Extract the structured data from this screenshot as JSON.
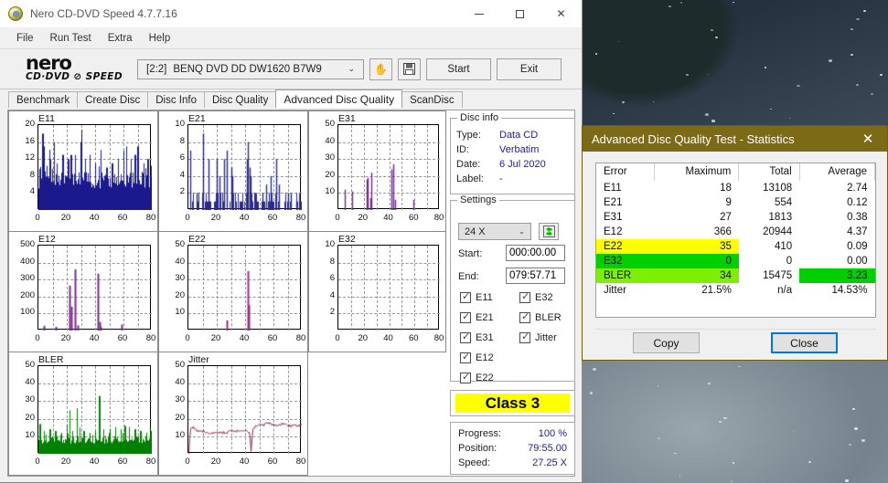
{
  "window": {
    "title": "Nero CD-DVD Speed 4.7.7.16",
    "icon": "nero-disc-icon",
    "controls": {
      "minimize": "–",
      "maximize": "□",
      "close": "✕"
    }
  },
  "menubar": {
    "items": [
      "File",
      "Run Test",
      "Extra",
      "Help"
    ]
  },
  "logo": {
    "line1": "nero",
    "line2": "CD·DVD ⊘ SPEED"
  },
  "toolbar": {
    "drive_bracket": "[2:2]",
    "drive_name": "BENQ DVD DD DW1620 B7W9",
    "chevron": "⌄",
    "eject_icon": "eject-hand-icon",
    "save_icon": "floppy-save-icon",
    "start_label": "Start",
    "exit_label": "Exit"
  },
  "tabs": {
    "items": [
      "Benchmark",
      "Create Disc",
      "Disc Info",
      "Disc Quality",
      "Advanced Disc Quality",
      "ScanDisc"
    ],
    "active": "Advanced Disc Quality"
  },
  "disc_info": {
    "legend": "Disc info",
    "rows": [
      {
        "key": "Type:",
        "value": "Data CD"
      },
      {
        "key": "ID:",
        "value": "Verbatim"
      },
      {
        "key": "Date:",
        "value": "6 Jul 2020"
      },
      {
        "key": "Label:",
        "value": "-"
      }
    ]
  },
  "settings": {
    "legend": "Settings",
    "speed": "24 X",
    "speed_chevron": "⌄",
    "refresh_icon": "refresh-speed-icon",
    "start_label": "Start:",
    "start_value": "000:00.00",
    "end_label": "End:",
    "end_value": "079:57.71",
    "checkboxes": [
      {
        "label": "E11",
        "checked": true
      },
      {
        "label": "E21",
        "checked": true
      },
      {
        "label": "E31",
        "checked": true
      },
      {
        "label": "E12",
        "checked": true
      },
      {
        "label": "E22",
        "checked": true
      },
      {
        "label": "E32",
        "checked": true
      },
      {
        "label": "BLER",
        "checked": true
      },
      {
        "label": "Jitter",
        "checked": true
      }
    ]
  },
  "class_rating": {
    "label": "Class 3",
    "background": "#ffff00"
  },
  "progress_panel": {
    "rows": [
      {
        "key": "Progress:",
        "value": "100 %"
      },
      {
        "key": "Position:",
        "value": "79:55.00"
      },
      {
        "key": "Speed:",
        "value": "27.25 X"
      }
    ]
  },
  "statistics_dialog": {
    "title": "Advanced Disc Quality Test - Statistics",
    "close_icon": "close-icon",
    "columns": [
      "Error",
      "Maximum",
      "Total",
      "Average"
    ],
    "rows": [
      {
        "error": "E11",
        "maximum": "18",
        "total": "13108",
        "average": "2.74",
        "highlight": "none"
      },
      {
        "error": "E21",
        "maximum": "9",
        "total": "554",
        "average": "0.12",
        "highlight": "none"
      },
      {
        "error": "E31",
        "maximum": "27",
        "total": "1813",
        "average": "0.38",
        "highlight": "none"
      },
      {
        "error": "E12",
        "maximum": "366",
        "total": "20944",
        "average": "4.37",
        "highlight": "none"
      },
      {
        "error": "E22",
        "maximum": "35",
        "total": "410",
        "average": "0.09",
        "highlight": "yellow"
      },
      {
        "error": "E32",
        "maximum": "0",
        "total": "0",
        "average": "0.00",
        "highlight": "green"
      },
      {
        "error": "BLER",
        "maximum": "34",
        "total": "15475",
        "average": "3.23",
        "highlight": "lightgreen-avggreen"
      },
      {
        "error": "Jitter",
        "maximum": "21.5%",
        "total": "n/a",
        "average": "14.53%",
        "highlight": "none"
      }
    ],
    "copy_label": "Copy",
    "close_label": "Close",
    "colors": {
      "titlebar": "#7c6a16",
      "yellow": "#ffff00",
      "green": "#00d000",
      "lightgreen": "#7cf000"
    }
  },
  "chart_data": [
    {
      "id": "e11",
      "type": "area",
      "title": "E11",
      "xlabel": "",
      "ylabel": "",
      "xlim": [
        0,
        80
      ],
      "ylim": [
        0,
        20
      ],
      "xticks": [
        0,
        20,
        40,
        60,
        80
      ],
      "yticks": [
        4,
        8,
        12,
        16,
        20
      ],
      "grid": true,
      "color": "#1a1a8c",
      "fill": true,
      "baseline": 7,
      "peaks": [
        [
          3,
          18
        ],
        [
          4,
          15
        ],
        [
          8,
          12
        ],
        [
          11,
          16
        ],
        [
          13,
          11
        ],
        [
          17,
          13
        ],
        [
          21,
          12
        ],
        [
          23,
          11
        ],
        [
          26,
          13
        ],
        [
          30,
          16
        ],
        [
          33,
          12
        ],
        [
          36,
          13
        ],
        [
          40,
          11
        ],
        [
          44,
          12
        ],
        [
          48,
          10
        ],
        [
          52,
          11
        ],
        [
          56,
          12
        ],
        [
          60,
          14
        ],
        [
          62,
          15
        ],
        [
          65,
          12
        ],
        [
          68,
          13
        ],
        [
          70,
          15
        ],
        [
          74,
          11
        ],
        [
          77,
          12
        ]
      ]
    },
    {
      "id": "e21",
      "type": "bar",
      "title": "E21",
      "xlabel": "",
      "ylabel": "",
      "xlim": [
        0,
        80
      ],
      "ylim": [
        0,
        10
      ],
      "xticks": [
        0,
        20,
        40,
        60,
        80
      ],
      "yticks": [
        2,
        4,
        6,
        8,
        10
      ],
      "grid": true,
      "color": "#2a2a8c",
      "baseline": 1,
      "peaks": [
        [
          1,
          7
        ],
        [
          6,
          2
        ],
        [
          10,
          9
        ],
        [
          14,
          6
        ],
        [
          20,
          6
        ],
        [
          22,
          4
        ],
        [
          25,
          6
        ],
        [
          27,
          7
        ],
        [
          30,
          5
        ],
        [
          31,
          4
        ],
        [
          41,
          6
        ],
        [
          42,
          8
        ],
        [
          43,
          5
        ],
        [
          44,
          4
        ],
        [
          52,
          2
        ],
        [
          55,
          3
        ],
        [
          58,
          4
        ],
        [
          62,
          6
        ],
        [
          64,
          3
        ],
        [
          70,
          2
        ],
        [
          72,
          2
        ],
        [
          76,
          1
        ]
      ]
    },
    {
      "id": "e31",
      "type": "bar",
      "title": "E31",
      "xlabel": "",
      "ylabel": "",
      "xlim": [
        0,
        80
      ],
      "ylim": [
        0,
        50
      ],
      "xticks": [
        0,
        20,
        40,
        60,
        80
      ],
      "yticks": [
        10,
        20,
        30,
        40,
        50
      ],
      "grid": true,
      "color": "#6a2a8c",
      "baseline": 0,
      "peaks": [
        [
          5,
          12
        ],
        [
          11,
          11
        ],
        [
          22,
          18
        ],
        [
          23,
          19
        ],
        [
          25,
          7
        ],
        [
          26,
          22
        ],
        [
          42,
          24
        ],
        [
          43,
          27
        ],
        [
          45,
          6
        ],
        [
          59,
          6
        ]
      ]
    },
    {
      "id": "e12",
      "type": "bar",
      "title": "E12",
      "xlabel": "",
      "ylabel": "",
      "xlim": [
        0,
        80
      ],
      "ylim": [
        0,
        500
      ],
      "xticks": [
        0,
        20,
        40,
        60,
        80
      ],
      "yticks": [
        100,
        200,
        300,
        400,
        500
      ],
      "grid": true,
      "color": "#7b2a8c",
      "baseline": 0,
      "peaks": [
        [
          4,
          28
        ],
        [
          12,
          22
        ],
        [
          22,
          265
        ],
        [
          23,
          140
        ],
        [
          26,
          360
        ],
        [
          28,
          30
        ],
        [
          42,
          335
        ],
        [
          43,
          50
        ],
        [
          44,
          20
        ],
        [
          59,
          35
        ]
      ]
    },
    {
      "id": "e22",
      "type": "bar",
      "title": "E22",
      "xlabel": "",
      "ylabel": "",
      "xlim": [
        0,
        80
      ],
      "ylim": [
        0,
        50
      ],
      "xticks": [
        0,
        20,
        40,
        60,
        80
      ],
      "yticks": [
        10,
        20,
        30,
        40,
        50
      ],
      "grid": true,
      "color": "#a02a8c",
      "baseline": 0,
      "peaks": [
        [
          27,
          6
        ],
        [
          42,
          35
        ],
        [
          42.8,
          15
        ]
      ]
    },
    {
      "id": "e32",
      "type": "bar",
      "title": "E32",
      "xlabel": "",
      "ylabel": "",
      "xlim": [
        0,
        80
      ],
      "ylim": [
        0,
        10
      ],
      "xticks": [
        0,
        20,
        40,
        60,
        80
      ],
      "yticks": [
        2,
        4,
        6,
        8,
        10
      ],
      "grid": true,
      "color": "#7b2a8c",
      "baseline": 0,
      "peaks": []
    },
    {
      "id": "bler",
      "type": "area",
      "title": "BLER",
      "xlabel": "",
      "ylabel": "",
      "xlim": [
        0,
        80
      ],
      "ylim": [
        0,
        50
      ],
      "xticks": [
        0,
        20,
        40,
        60,
        80
      ],
      "yticks": [
        10,
        20,
        30,
        40,
        50
      ],
      "grid": true,
      "color": "#008000",
      "fill": true,
      "baseline": 8,
      "peaks": [
        [
          1,
          17
        ],
        [
          4,
          13
        ],
        [
          8,
          14
        ],
        [
          12,
          13
        ],
        [
          16,
          12
        ],
        [
          20,
          14
        ],
        [
          22,
          21
        ],
        [
          24,
          13
        ],
        [
          27,
          26
        ],
        [
          29,
          15
        ],
        [
          32,
          13
        ],
        [
          36,
          12
        ],
        [
          40,
          13
        ],
        [
          43,
          33
        ],
        [
          46,
          14
        ],
        [
          50,
          12
        ],
        [
          54,
          13
        ],
        [
          58,
          14
        ],
        [
          61,
          16
        ],
        [
          64,
          13
        ],
        [
          68,
          14
        ],
        [
          72,
          13
        ],
        [
          76,
          12
        ],
        [
          79,
          13
        ]
      ]
    },
    {
      "id": "jitter",
      "type": "line",
      "title": "Jitter",
      "xlabel": "",
      "ylabel": "",
      "xlim": [
        0,
        80
      ],
      "ylim": [
        0,
        50
      ],
      "xticks": [
        0,
        20,
        40,
        60,
        80
      ],
      "yticks": [
        10,
        20,
        30,
        40,
        50
      ],
      "grid": true,
      "color": "#8c1a4a",
      "fill": false,
      "baseline": 13,
      "series_points": [
        [
          0,
          0
        ],
        [
          1,
          14
        ],
        [
          3,
          15
        ],
        [
          6,
          13
        ],
        [
          10,
          13
        ],
        [
          14,
          12
        ],
        [
          18,
          12
        ],
        [
          22,
          12
        ],
        [
          26,
          12
        ],
        [
          30,
          13
        ],
        [
          34,
          13
        ],
        [
          38,
          13
        ],
        [
          41,
          13
        ],
        [
          43,
          12
        ],
        [
          44,
          0
        ],
        [
          45,
          14
        ],
        [
          47,
          16
        ],
        [
          50,
          17
        ],
        [
          52,
          16
        ],
        [
          55,
          18
        ],
        [
          58,
          17
        ],
        [
          60,
          16
        ],
        [
          63,
          16
        ],
        [
          66,
          17
        ],
        [
          70,
          16
        ],
        [
          74,
          16
        ],
        [
          77,
          16
        ],
        [
          80,
          17
        ]
      ]
    }
  ]
}
